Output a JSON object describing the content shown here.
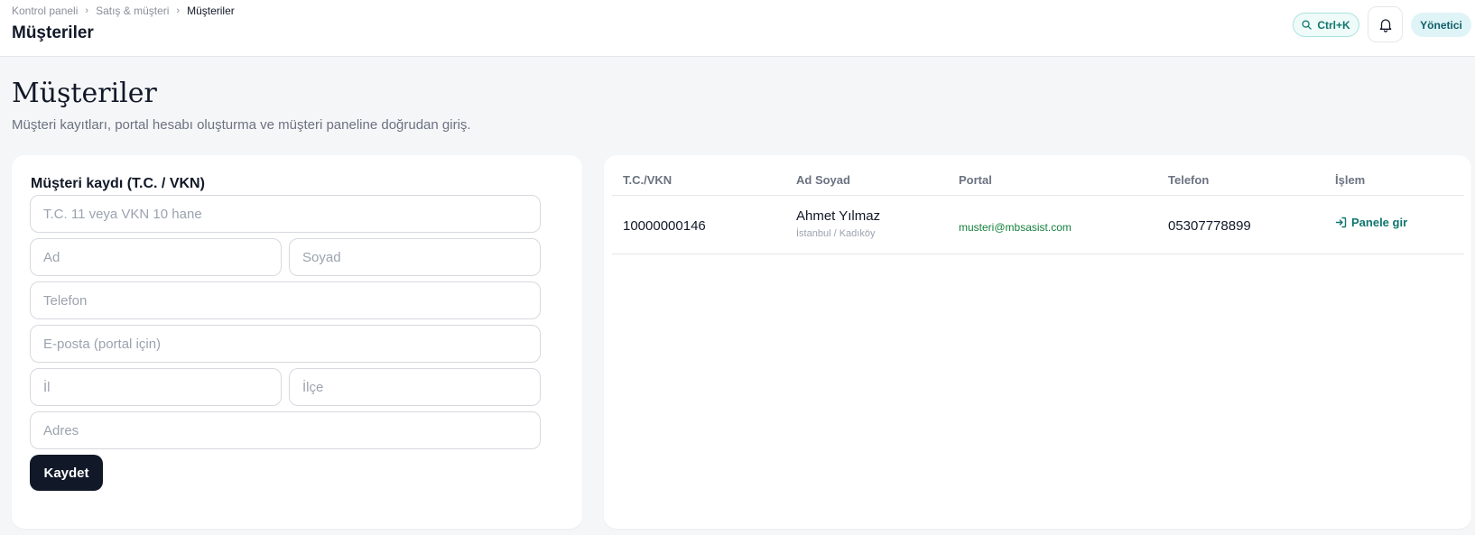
{
  "breadcrumb": [
    "Kontrol paneli",
    "Satış & müşteri",
    "Müşteriler"
  ],
  "header": {
    "title": "Müşteriler",
    "search_shortcut": "Ctrl+K",
    "role": "Yönetici"
  },
  "page": {
    "title": "Müşteriler",
    "subtitle": "Müşteri kayıtları, portal hesabı oluşturma ve müşteri paneline doğrudan giriş."
  },
  "form": {
    "title": "Müşteri kaydı (T.C. / VKN)",
    "placeholders": {
      "tc": "T.C. 11 veya VKN 10 hane",
      "first_name": "Ad",
      "last_name": "Soyad",
      "phone": "Telefon",
      "email": "E-posta (portal için)",
      "city": "İl",
      "district": "İlçe",
      "address": "Adres"
    },
    "save_label": "Kaydet"
  },
  "table": {
    "columns": [
      "T.C./VKN",
      "Ad Soyad",
      "Portal",
      "Telefon",
      "İşlem"
    ],
    "rows": [
      {
        "tc": "10000000146",
        "name": "Ahmet Yılmaz",
        "location": "İstanbul / Kadıköy",
        "portal": "musteri@mbsasist.com",
        "phone": "05307778899",
        "action": "Panele gir"
      }
    ]
  },
  "icons": {
    "search": "search-icon",
    "bell": "bell-icon",
    "login": "login-arrow-icon",
    "chevron": "chevron-right-icon"
  },
  "colors": {
    "accent": "#0f766e",
    "portal_link": "#15803d",
    "primary_button": "#111827"
  }
}
